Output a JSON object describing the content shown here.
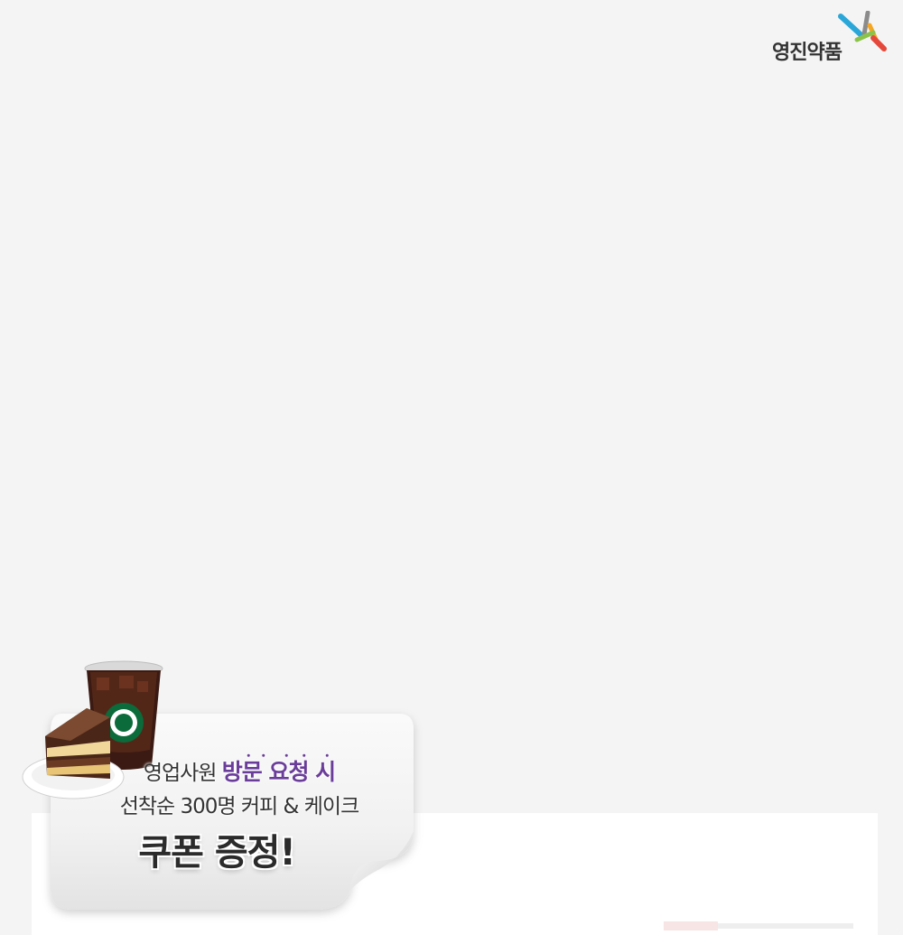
{
  "brand": {
    "name": "영진약품",
    "logo_colors": [
      "#e5483a",
      "#2aa7d8",
      "#f5a623",
      "#8bc34a"
    ]
  },
  "promo": {
    "line1_prefix": "영업사원",
    "line1_emphasis": "방문 요청 시",
    "line2": "선착순 300명 커피 & 케이크",
    "line3": "쿠폰 증정!",
    "accent_color": "#6b3d9a"
  }
}
